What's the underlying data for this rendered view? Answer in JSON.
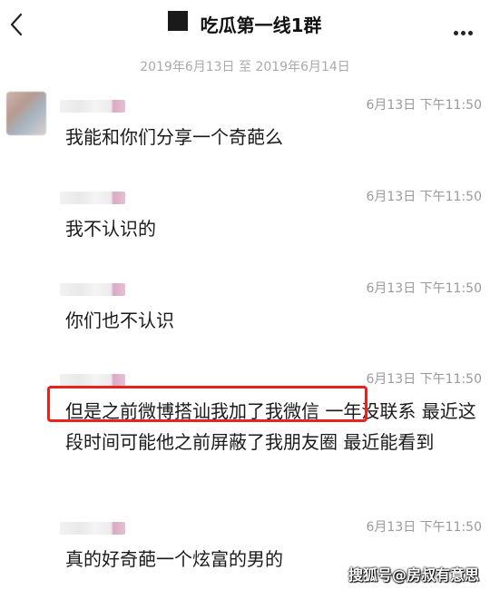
{
  "header": {
    "title": "吃瓜第一线1群"
  },
  "date_range": "2019年6月13日 至 2019年6月14日",
  "messages": [
    {
      "time": "6月13日 下午11:50",
      "text": "我能和你们分享一个奇葩么"
    },
    {
      "time": "6月13日 下午11:50",
      "text": "我不认识的"
    },
    {
      "time": "6月13日 下午11:50",
      "text": "你们也不认识"
    },
    {
      "time": "6月13日 下午11:50",
      "text": "但是之前微博搭讪我加了我微信 一年没联系 最近这段时间可能他之前屏蔽了我朋友圈 最近能看到"
    },
    {
      "time": "6月13日 下午11:50",
      "text": "真的好奇葩一个炫富的男的"
    }
  ],
  "watermark": "搜狐号@房叔有意思",
  "colors": {
    "highlight": "#e8231f",
    "time_text": "#9a9a9a",
    "date_text": "#aaaaaa"
  }
}
